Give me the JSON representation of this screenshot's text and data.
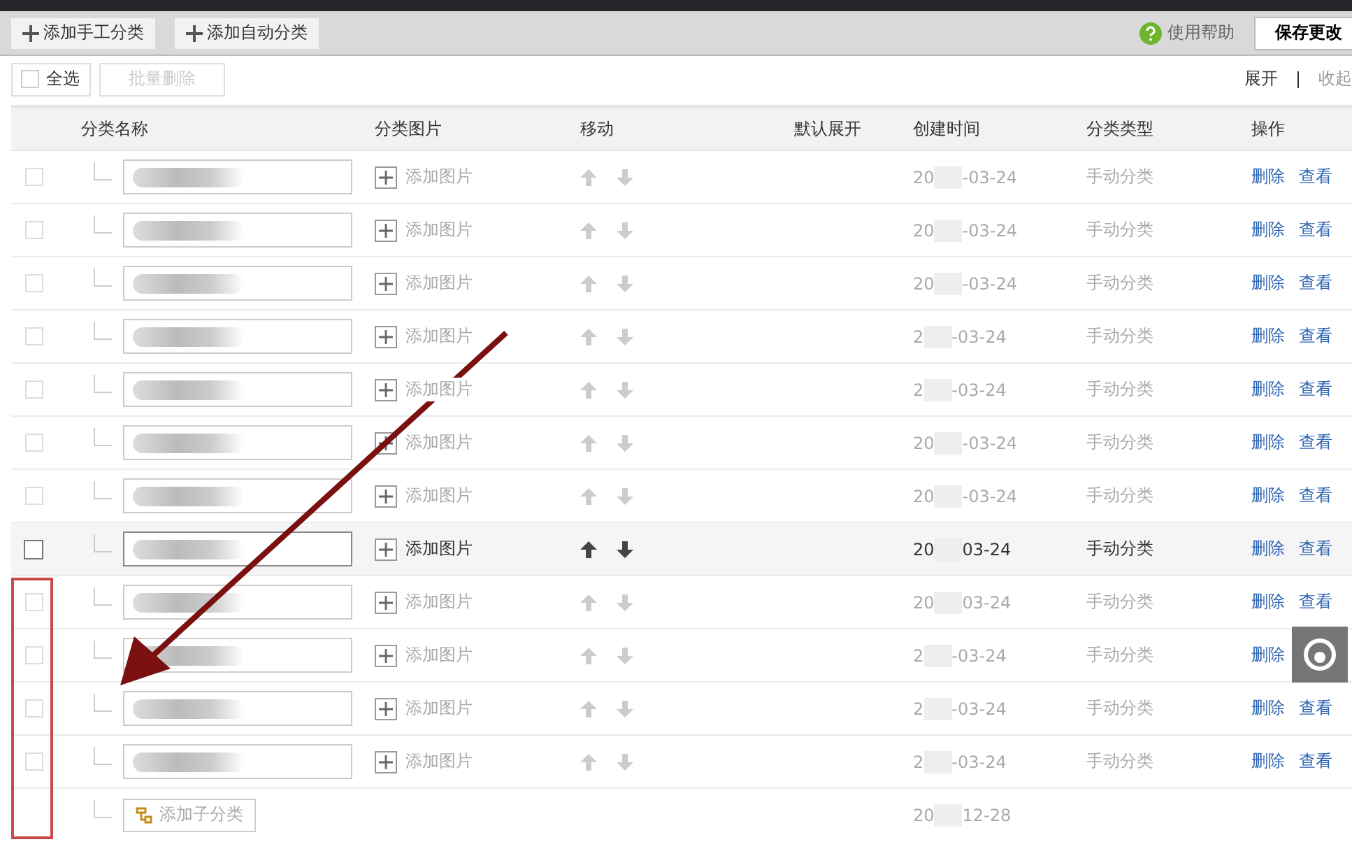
{
  "toolbar": {
    "add_buttons": [
      "添加手工分类",
      "添加自动分类"
    ],
    "help": "使用帮助",
    "save": "保存更改"
  },
  "bulk": {
    "select_all": "全选",
    "select_all_checked": false,
    "delete": "批量删除",
    "delete_disabled": true
  },
  "expand_links": [
    {
      "label": "展开",
      "disabled": false
    },
    {
      "label": "收起",
      "disabled": true
    }
  ],
  "table": {
    "columns": [
      "分类名称",
      "分类图片",
      "移动",
      "默认展开",
      "创建时间",
      "分类类型",
      "操作"
    ],
    "rows": [
      {
        "highlighted": false,
        "checked": false,
        "image": "添加图片",
        "date_start": "20",
        "date_end": "-03-24",
        "type": "手动分类",
        "actions": [
          "删除",
          "查看"
        ]
      },
      {
        "highlighted": false,
        "checked": false,
        "image": "添加图片",
        "date_start": "20",
        "date_end": "-03-24",
        "type": "手动分类",
        "actions": [
          "删除",
          "查看"
        ]
      },
      {
        "highlighted": false,
        "checked": false,
        "image": "添加图片",
        "date_start": "20",
        "date_end": "-03-24",
        "type": "手动分类",
        "actions": [
          "删除",
          "查看"
        ]
      },
      {
        "highlighted": false,
        "checked": false,
        "image": "添加图片",
        "date_start": "2",
        "date_end": "-03-24",
        "type": "手动分类",
        "actions": [
          "删除",
          "查看"
        ]
      },
      {
        "highlighted": false,
        "checked": false,
        "image": "添加图片",
        "date_start": "2",
        "date_end": "-03-24",
        "type": "手动分类",
        "actions": [
          "删除",
          "查看"
        ]
      },
      {
        "highlighted": false,
        "checked": false,
        "image": "添加图片",
        "date_start": "20",
        "date_end": "-03-24",
        "type": "手动分类",
        "actions": [
          "删除",
          "查看"
        ]
      },
      {
        "highlighted": false,
        "checked": false,
        "image": "添加图片",
        "date_start": "20",
        "date_end": "-03-24",
        "type": "手动分类",
        "actions": [
          "删除",
          "查看"
        ]
      },
      {
        "highlighted": true,
        "checked": false,
        "image": "添加图片",
        "date_start": "20",
        "date_end": "03-24",
        "type": "手动分类",
        "actions": [
          "删除",
          "查看"
        ]
      },
      {
        "highlighted": false,
        "checked": false,
        "image": "添加图片",
        "date_start": "20",
        "date_end": "03-24",
        "type": "手动分类",
        "actions": [
          "删除",
          "查看"
        ]
      },
      {
        "highlighted": false,
        "checked": false,
        "image": "添加图片",
        "date_start": "2",
        "date_end": "-03-24",
        "type": "手动分类",
        "actions": [
          "删除"
        ]
      },
      {
        "highlighted": false,
        "checked": false,
        "image": "添加图片",
        "date_start": "2",
        "date_end": "-03-24",
        "type": "手动分类",
        "actions": [
          "删除",
          "查看"
        ]
      },
      {
        "highlighted": false,
        "checked": false,
        "image": "添加图片",
        "date_start": "2",
        "date_end": "-03-24",
        "type": "手动分类",
        "actions": [
          "删除",
          "查看"
        ]
      }
    ],
    "add_child": {
      "label": "添加子分类",
      "date_start": "20",
      "date_end": "12-28"
    }
  }
}
